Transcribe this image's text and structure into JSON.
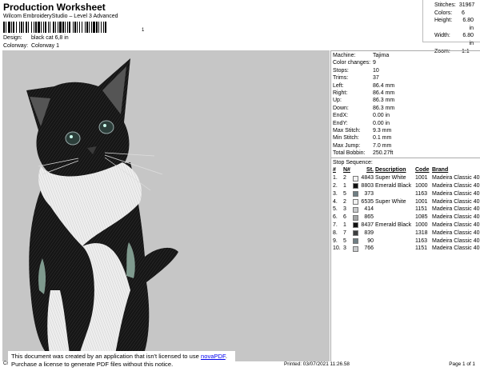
{
  "header": {
    "title": "Production Worksheet",
    "subtitle": "Wilcom EmbroideryStudio – Level 3 Advanced",
    "barcode_suffix": "1",
    "design_label": "Design:",
    "design_value": "black cat 6,8 in",
    "colorway_label": "Colorway:",
    "colorway_value": "Colorway 1"
  },
  "stats": [
    {
      "label": "Stitches:",
      "value": "31967",
      "align": "plain"
    },
    {
      "label": "Colors:",
      "value": "6",
      "align": "plain"
    },
    {
      "label": "Height:",
      "value": "6.80 in",
      "align": "right"
    },
    {
      "label": "Width:",
      "value": "6.80 in",
      "align": "right"
    },
    {
      "label": "Zoom:",
      "value": "1:1",
      "align": "plain"
    }
  ],
  "params": [
    {
      "label": "Machine:",
      "value": "Tajima"
    },
    {
      "label": "Color changes:",
      "value": "9"
    },
    {
      "label": "Stops:",
      "value": "10"
    },
    {
      "label": "Trims:",
      "value": "37"
    },
    {
      "label": "Left:",
      "value": "86.4 mm"
    },
    {
      "label": "Right:",
      "value": "86.4 mm"
    },
    {
      "label": "Up:",
      "value": "86.3 mm"
    },
    {
      "label": "Down:",
      "value": "86.3 mm"
    },
    {
      "label": "EndX:",
      "value": "0.00 in"
    },
    {
      "label": "EndY:",
      "value": "0.00 in"
    },
    {
      "label": "Max Stitch:",
      "value": "9.3 mm"
    },
    {
      "label": "Min Stitch:",
      "value": "0.1 mm"
    },
    {
      "label": "Max Jump:",
      "value": "7.0 mm"
    },
    {
      "label": "Total Bobbin:",
      "value": "250.27ft"
    }
  ],
  "stop_sequence": {
    "title": "Stop Sequence:",
    "headers": {
      "n": "#",
      "needle": "N#",
      "st": "St.",
      "desc": "Description",
      "code": "Code",
      "brand": "Brand"
    },
    "rows": [
      {
        "n": "1.",
        "needle": "2",
        "color": "#f2f2f2",
        "st": "4843",
        "desc": "Super White",
        "code": "1001",
        "brand": "Madeira Classic 40"
      },
      {
        "n": "2.",
        "needle": "1",
        "color": "#111111",
        "st": "8803",
        "desc": "Emerald Black",
        "code": "1000",
        "brand": "Madeira Classic 40"
      },
      {
        "n": "3.",
        "needle": "5",
        "color": "#6f7f84",
        "st": "373",
        "desc": "",
        "code": "1163",
        "brand": "Madeira Classic 40"
      },
      {
        "n": "4.",
        "needle": "2",
        "color": "#f2f2f2",
        "st": "6535",
        "desc": "Super White",
        "code": "1001",
        "brand": "Madeira Classic 40"
      },
      {
        "n": "5.",
        "needle": "3",
        "color": "#c9cbcd",
        "st": "414",
        "desc": "",
        "code": "1151",
        "brand": "Madeira Classic 40"
      },
      {
        "n": "6.",
        "needle": "6",
        "color": "#a3a5a6",
        "st": "865",
        "desc": "",
        "code": "1085",
        "brand": "Madeira Classic 40"
      },
      {
        "n": "7.",
        "needle": "1",
        "color": "#111111",
        "st": "8437",
        "desc": "Emerald Black",
        "code": "1000",
        "brand": "Madeira Classic 40"
      },
      {
        "n": "8.",
        "needle": "7",
        "color": "#3c3d3e",
        "st": "839",
        "desc": "",
        "code": "1318",
        "brand": "Madeira Classic 40"
      },
      {
        "n": "9.",
        "needle": "5",
        "color": "#6f7f84",
        "st": "90",
        "desc": "",
        "code": "1163",
        "brand": "Madeira Classic 40"
      },
      {
        "n": "10.",
        "needle": "3",
        "color": "#c9cbcd",
        "st": "766",
        "desc": "",
        "code": "1151",
        "brand": "Madeira Classic 40"
      }
    ]
  },
  "footer": {
    "left_fragment": "Cr",
    "printed": "Printed: 03/07/2021 11:26.58",
    "page": "Page 1 of 1",
    "notice_line1": "This document was created by an application that isn't licensed to use ",
    "notice_link": "novaPDF",
    "notice_line1_end": ".",
    "notice_line2": "Purchase a license to generate PDF files without this notice."
  },
  "design_image": {
    "subject": "embroidered black and white cat",
    "background": "#c6c6c6"
  }
}
